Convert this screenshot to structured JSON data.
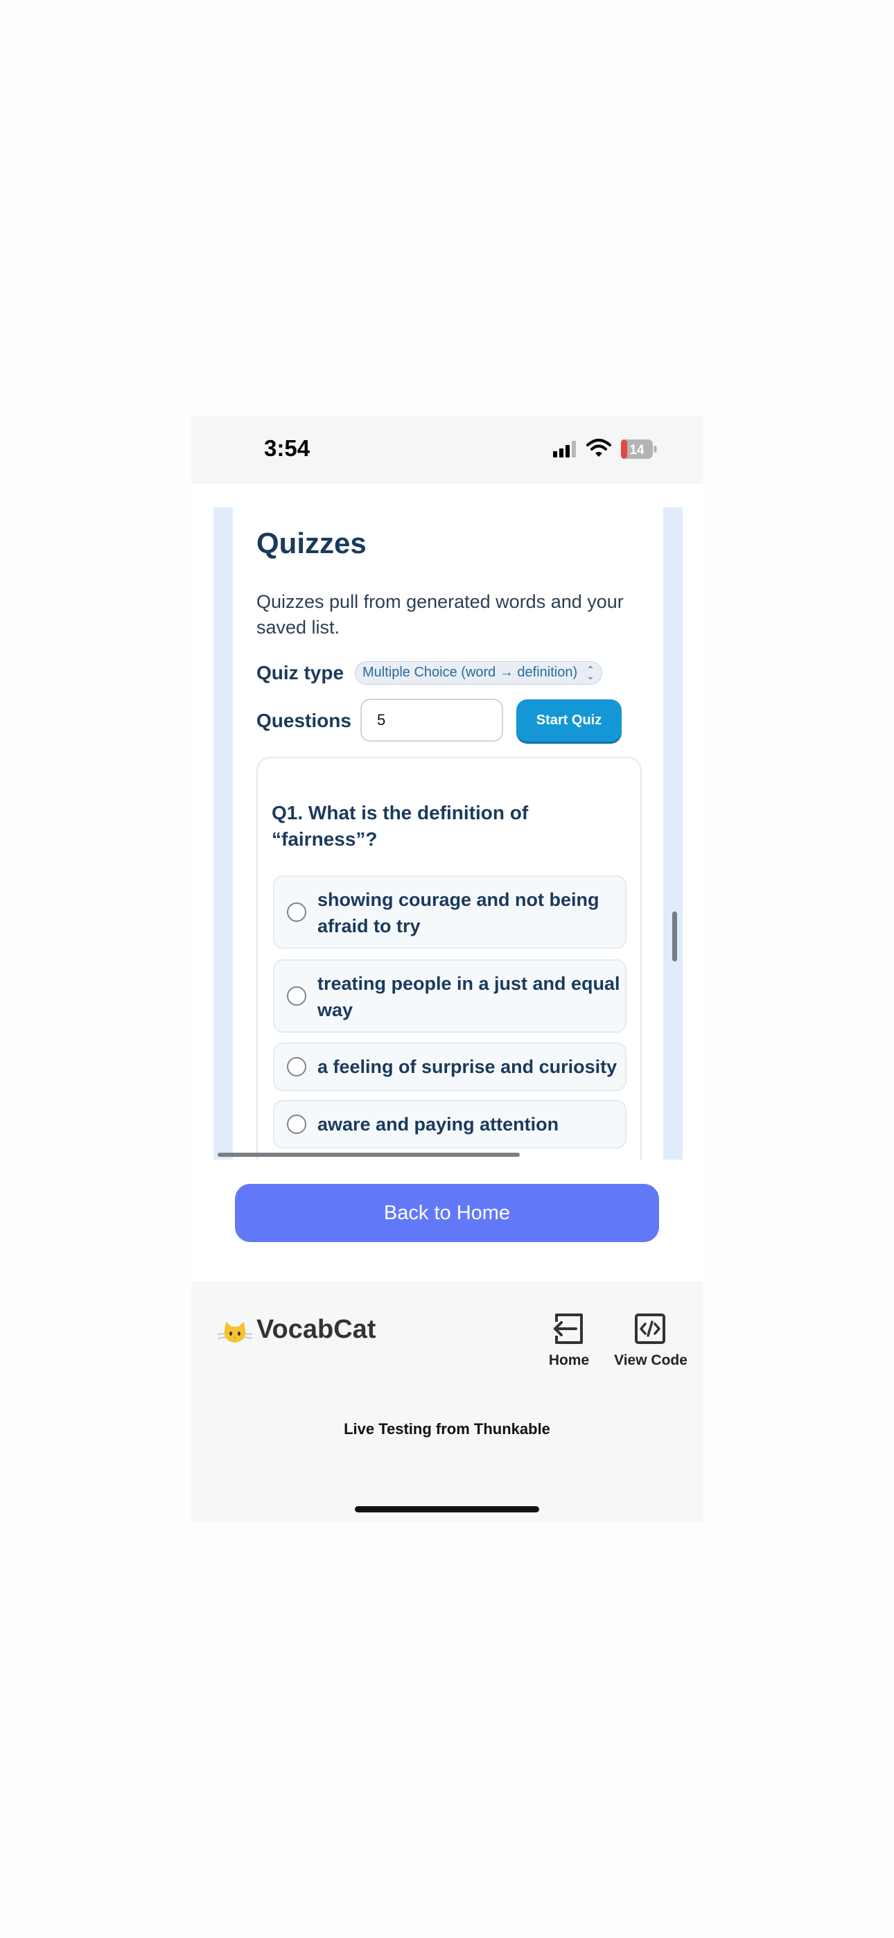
{
  "status_bar": {
    "time": "3:54",
    "battery_level": "14",
    "icons": [
      "signal-icon",
      "wifi-icon",
      "battery-icon"
    ]
  },
  "quiz_page": {
    "title": "Quizzes",
    "description": "Quizzes pull from generated words and your saved list.",
    "quiz_type_label": "Quiz type",
    "quiz_type_value": "Multiple Choice (word → definition)",
    "questions_label": "Questions",
    "questions_value": "5",
    "start_button": "Start Quiz"
  },
  "question": {
    "text": "Q1. What is the definition of “fairness”?",
    "options": [
      "showing courage and not being afraid to try",
      "treating people in a just and equal way",
      "a feeling of surprise and curiosity",
      "aware and paying attention"
    ]
  },
  "back_home_button": "Back to Home",
  "app_bar": {
    "brand": "VocabCat",
    "nav": [
      {
        "label": "Home",
        "icon": "exit-arrow-icon"
      },
      {
        "label": "View Code",
        "icon": "code-icon"
      }
    ],
    "footer_text": "Live Testing from Thunkable"
  },
  "colors": {
    "primary_text": "#1a3a5c",
    "accent_blue": "#1497d4",
    "home_button": "#6279f7",
    "battery_low": "#e5493a"
  }
}
